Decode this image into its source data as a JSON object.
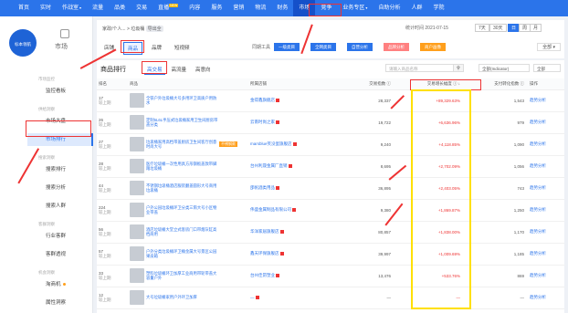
{
  "topnav": {
    "items": [
      {
        "label": "首页"
      },
      {
        "label": "实时"
      },
      {
        "label": "作战室",
        "caret": "▾"
      },
      {
        "label": "流量"
      },
      {
        "label": "品类"
      },
      {
        "label": "交易"
      },
      {
        "label": "直播",
        "badge": "NEW"
      },
      {
        "label": "内容"
      },
      {
        "label": "服务"
      },
      {
        "label": "营销"
      },
      {
        "label": "物流"
      },
      {
        "label": "财务"
      },
      {
        "label": "市场",
        "active": true
      },
      {
        "label": "竞争"
      },
      {
        "label": "业务专区",
        "caret": "▾"
      },
      {
        "label": "自助分析"
      },
      {
        "label": "人群"
      },
      {
        "label": "学院"
      }
    ]
  },
  "sidebar": {
    "logo_text": "标本领航",
    "market_label": "市场",
    "sections": [
      {
        "title": "市场监控",
        "items": [
          {
            "label": "监控看板"
          }
        ]
      },
      {
        "title": "供给洞察",
        "items": [
          {
            "label": "市场大盘"
          },
          {
            "label": "市场排行",
            "active": true
          }
        ]
      },
      {
        "title": "搜索洞察",
        "items": [
          {
            "label": "搜索排行"
          },
          {
            "label": "搜索分析"
          },
          {
            "label": "搜索人群"
          }
        ]
      },
      {
        "title": "客群洞察",
        "items": [
          {
            "label": "行业客群"
          },
          {
            "label": "客群透视"
          }
        ]
      },
      {
        "title": "机会洞察",
        "items": [
          {
            "label": "淘商机",
            "dot": true
          },
          {
            "label": "属性洞察"
          },
          {
            "label": "产品洞察"
          }
        ]
      }
    ]
  },
  "filters": {
    "breadcrumb": "家政/个人... > 垃圾桶",
    "breadcrumb_pill": "导出全",
    "date_label": "统计时间 2021-07-15",
    "range_buttons": [
      "7天",
      "30天"
    ],
    "day_buttons": [
      "日",
      "周",
      "月"
    ],
    "tabs": [
      {
        "label": "店铺"
      },
      {
        "label": "商品",
        "active": true
      },
      {
        "label": "品牌"
      },
      {
        "label": "短视频"
      }
    ],
    "terminal_label": "同期工具",
    "terminal_buttons": [
      {
        "label": "一级类目"
      },
      {
        "label": "全网类目"
      },
      {
        "label": "自营分析"
      },
      {
        "label": "品牌分析"
      },
      {
        "label": "商户画像"
      }
    ],
    "terminal_colors": [
      "#2b74ea",
      "#2b74ea",
      "#2b74ea",
      "#ff8080",
      "#ff9f1c"
    ],
    "all_select": "全部 ▾"
  },
  "main": {
    "title": "商品排行",
    "subtabs": [
      {
        "label": "高交易",
        "active": true
      },
      {
        "label": "高流量"
      },
      {
        "label": "高意向"
      }
    ],
    "search_placeholder": "请输入商品名称",
    "select1": "全部(Indicator)",
    "select2": "全部",
    "columns": [
      "排名",
      "商品",
      "所属店铺",
      "交易指数 ⓘ",
      "交易增长幅度 ⓘ ↓",
      "支付转化指数 ⓘ",
      "操作"
    ],
    "rows": [
      {
        "rank": "17",
        "rank_change": "较上期",
        "name": "全铁户外垃圾桶大号多用环卫高质户用防水",
        "tag": "",
        "shop": "金得鑫旗舰店",
        "trade_index": "28,337",
        "growth": "+89,329.63%",
        "conv_index": "1,543",
        "action": "趋势分析"
      },
      {
        "rank": "26",
        "rank_change": "较上期",
        "name": "定制5L6L手压式垃圾桶家用卫生间厨房带盖分类",
        "tag": "",
        "shop": "云南时尚之家",
        "trade_index": "19,722",
        "growth": "+6,636.96%",
        "conv_index": "979",
        "action": "趋势分析"
      },
      {
        "rank": "27",
        "rank_change": "较上期",
        "name": "垃圾桶家用高档带盖厨房卫生间客厅创意时尚大号",
        "tag": "不锈钢款",
        "shop": "marsblue笑没蛋旗舰店",
        "trade_index": "9,240",
        "growth": "+4,118.85%",
        "conv_index": "1,090",
        "action": "趋势分析"
      },
      {
        "rank": "28",
        "rank_change": "较上期",
        "name": "医疗垃圾桶一次性用具方形钢板盖款带脚踏垃圾桶",
        "tag": "",
        "shop": "台州利晟金属厂直销",
        "trade_index": "8,695",
        "growth": "+2,702.09%",
        "conv_index": "1,056",
        "action": "趋势分析"
      },
      {
        "rank": "44",
        "rank_change": "较上期",
        "name": "不锈钢垃圾桶酒店服装翻盖圆形大号商用垃圾桶",
        "tag": "",
        "shop": "邵帆酒类用品",
        "trade_index": "36,895",
        "growth": "+2,403.05%",
        "conv_index": "743",
        "action": "趋势分析"
      },
      {
        "rank": "224",
        "rank_change": "较上期",
        "name": "户外公园垃圾桶环卫分类三筒大号小区物业带盖",
        "tag": "",
        "shop": "伟盛金属制品有限公司",
        "trade_index": "9,380",
        "growth": "+1,869.87%",
        "conv_index": "1,250",
        "action": "趋势分析"
      },
      {
        "rank": "56",
        "rank_change": "较上期",
        "name": "酒店垃圾桶大堂立式客房门口带烟灰缸高档商用",
        "tag": "",
        "shop": "华洋家居旗舰店",
        "trade_index": "80,857",
        "growth": "+1,838.00%",
        "conv_index": "1,170",
        "action": "趋势分析"
      },
      {
        "rank": "57",
        "rank_change": "较上期",
        "name": "户外分类垃圾桶环卫桶金属大号景区公园果皮箱",
        "tag": "",
        "shop": "鑫天环保旗舰店",
        "trade_index": "39,997",
        "growth": "+1,009.69%",
        "conv_index": "1,185",
        "action": "趋势分析"
      },
      {
        "rank": "33",
        "rank_change": "较上期",
        "name": "塑料垃圾桶环卫加厚工业商用带轮带盖大容量户外",
        "tag": "",
        "shop": "台州佳昂塑业",
        "trade_index": "13,476",
        "growth": "+533.76%",
        "conv_index": "869",
        "action": "趋势分析"
      },
      {
        "rank": "12",
        "rank_change": "较上期",
        "name": "大号垃圾桶家用户外环卫加厚",
        "tag": "",
        "shop": "—",
        "trade_index": "—",
        "growth": "—",
        "conv_index": "—",
        "action": "趋势分析"
      }
    ]
  }
}
